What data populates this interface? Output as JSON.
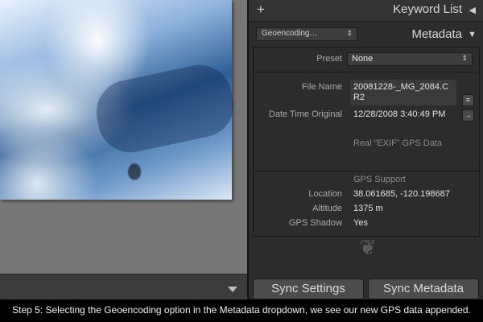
{
  "keyword_list": {
    "title": "Keyword List"
  },
  "metadata": {
    "title": "Metadata",
    "dropdown_value": "Geoencoding…",
    "preset_label": "Preset",
    "preset_value": "None",
    "file_name_label": "File Name",
    "file_name_value": "20081228-_MG_2084.CR2",
    "date_label": "Date Time Original",
    "date_value": "12/28/2008 3:40:49 PM",
    "exif_note": "Real “EXIF” GPS Data",
    "gps_support": "GPS Support",
    "location_label": "Location",
    "location_value": "38.061685, -120.198687",
    "altitude_label": "Altitude",
    "altitude_value": "1375 m",
    "shadow_label": "GPS Shadow",
    "shadow_value": "Yes"
  },
  "buttons": {
    "sync_settings": "Sync Settings",
    "sync_metadata": "Sync Metadata"
  },
  "caption": "Step 5: Selecting the Geoencoding option in the Metadata dropdown, we see our new GPS data appended."
}
